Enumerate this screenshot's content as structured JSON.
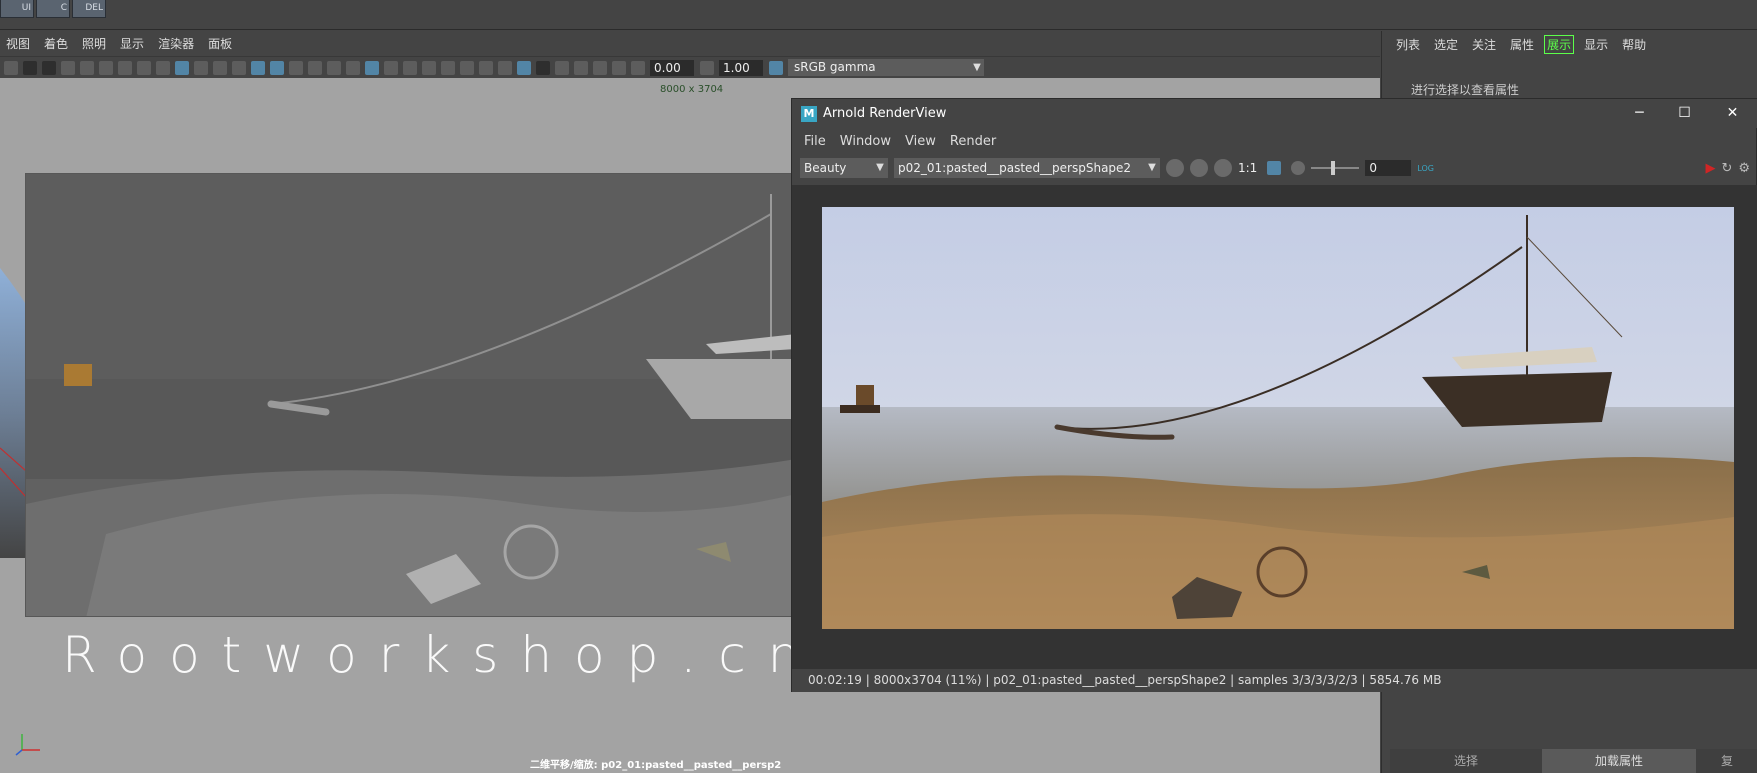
{
  "shelf": {
    "btn1": "UI",
    "btn2": "C",
    "btn3": "DEL"
  },
  "viewport": {
    "menu": [
      "视图",
      "着色",
      "照明",
      "显示",
      "渲染器",
      "面板"
    ],
    "exposure": "0.00",
    "gamma_value": "1.00",
    "color_space": "sRGB gamma",
    "resolution": "8000 x 3704",
    "watermark": "Rootworkshop.cn",
    "camera_label": "二维平移/缩放: p02_01:pasted__pasted__persp2"
  },
  "right_panel": {
    "menu": [
      "列表",
      "选定",
      "关注",
      "属性",
      "展示",
      "显示",
      "帮助"
    ],
    "hint": "进行选择以查看属性",
    "tabs": [
      "选择",
      "加载属性",
      "复"
    ]
  },
  "arnold": {
    "title": "Arnold RenderView",
    "logo": "M",
    "menu": [
      "File",
      "Window",
      "View",
      "Render"
    ],
    "aov": "Beauty",
    "camera": "p02_01:pasted__pasted__perspShape2",
    "ratio": "1:1",
    "exposure": "0",
    "log": "LOG",
    "status": "00:02:19 | 8000x3704 (11%) | p02_01:pasted__pasted__perspShape2  | samples 3/3/3/3/2/3 | 5854.76 MB"
  },
  "colors": {
    "active_tab": "#5cff4a",
    "toolbar_on": "#5285a6",
    "sky": "#c9d2e6",
    "sand": "#a88357"
  }
}
